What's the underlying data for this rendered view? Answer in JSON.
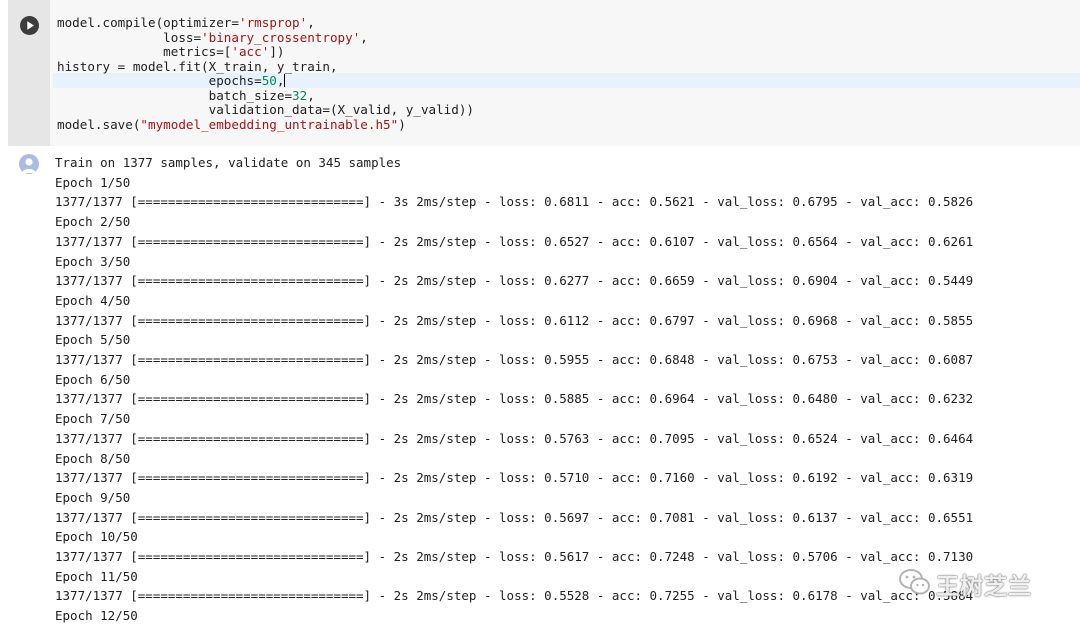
{
  "code_cell": {
    "run_button_icon": "play-icon",
    "lines": [
      "model.compile(optimizer='rmsprop',",
      "              loss='binary_crossentropy',",
      "              metrics=['acc'])",
      "history = model.fit(X_train, y_train,",
      "                    epochs=50,",
      "                    batch_size=32,",
      "                    validation_data=(X_valid, y_valid))",
      "model.save(\"mymodel_embedding_untrainable.h5\")"
    ]
  },
  "output_cell": {
    "avatar_icon": "output-user-icon",
    "header": "Train on 1377 samples, validate on 345 samples",
    "epochs": [
      {
        "label": "Epoch 1/50",
        "progress": "1377/1377 [==============================] - 3s 2ms/step - loss: 0.6811 - acc: 0.5621 - val_loss: 0.6795 - val_acc: 0.5826"
      },
      {
        "label": "Epoch 2/50",
        "progress": "1377/1377 [==============================] - 2s 2ms/step - loss: 0.6527 - acc: 0.6107 - val_loss: 0.6564 - val_acc: 0.6261"
      },
      {
        "label": "Epoch 3/50",
        "progress": "1377/1377 [==============================] - 2s 2ms/step - loss: 0.6277 - acc: 0.6659 - val_loss: 0.6904 - val_acc: 0.5449"
      },
      {
        "label": "Epoch 4/50",
        "progress": "1377/1377 [==============================] - 2s 2ms/step - loss: 0.6112 - acc: 0.6797 - val_loss: 0.6968 - val_acc: 0.5855"
      },
      {
        "label": "Epoch 5/50",
        "progress": "1377/1377 [==============================] - 2s 2ms/step - loss: 0.5955 - acc: 0.6848 - val_loss: 0.6753 - val_acc: 0.6087"
      },
      {
        "label": "Epoch 6/50",
        "progress": "1377/1377 [==============================] - 2s 2ms/step - loss: 0.5885 - acc: 0.6964 - val_loss: 0.6480 - val_acc: 0.6232"
      },
      {
        "label": "Epoch 7/50",
        "progress": "1377/1377 [==============================] - 2s 2ms/step - loss: 0.5763 - acc: 0.7095 - val_loss: 0.6524 - val_acc: 0.6464"
      },
      {
        "label": "Epoch 8/50",
        "progress": "1377/1377 [==============================] - 2s 2ms/step - loss: 0.5710 - acc: 0.7160 - val_loss: 0.6192 - val_acc: 0.6319"
      },
      {
        "label": "Epoch 9/50",
        "progress": "1377/1377 [==============================] - 2s 2ms/step - loss: 0.5697 - acc: 0.7081 - val_loss: 0.6137 - val_acc: 0.6551"
      },
      {
        "label": "Epoch 10/50",
        "progress": "1377/1377 [==============================] - 2s 2ms/step - loss: 0.5617 - acc: 0.7248 - val_loss: 0.5706 - val_acc: 0.7130"
      },
      {
        "label": "Epoch 11/50",
        "progress": "1377/1377 [==============================] - 2s 2ms/step - loss: 0.5528 - acc: 0.7255 - val_loss: 0.6178 - val_acc: 0.5884"
      },
      {
        "label": "Epoch 12/50",
        "progress": ""
      }
    ]
  },
  "watermark": {
    "icon": "wechat-logo-icon",
    "text": "王树芝兰"
  },
  "colors": {
    "gutter": "#e6e6e6",
    "editor_background": "#f7f7f7",
    "cursor_line": "#e8f2fd",
    "string": "#a31515",
    "number": "#09885a",
    "avatar": "#a9bde0"
  }
}
